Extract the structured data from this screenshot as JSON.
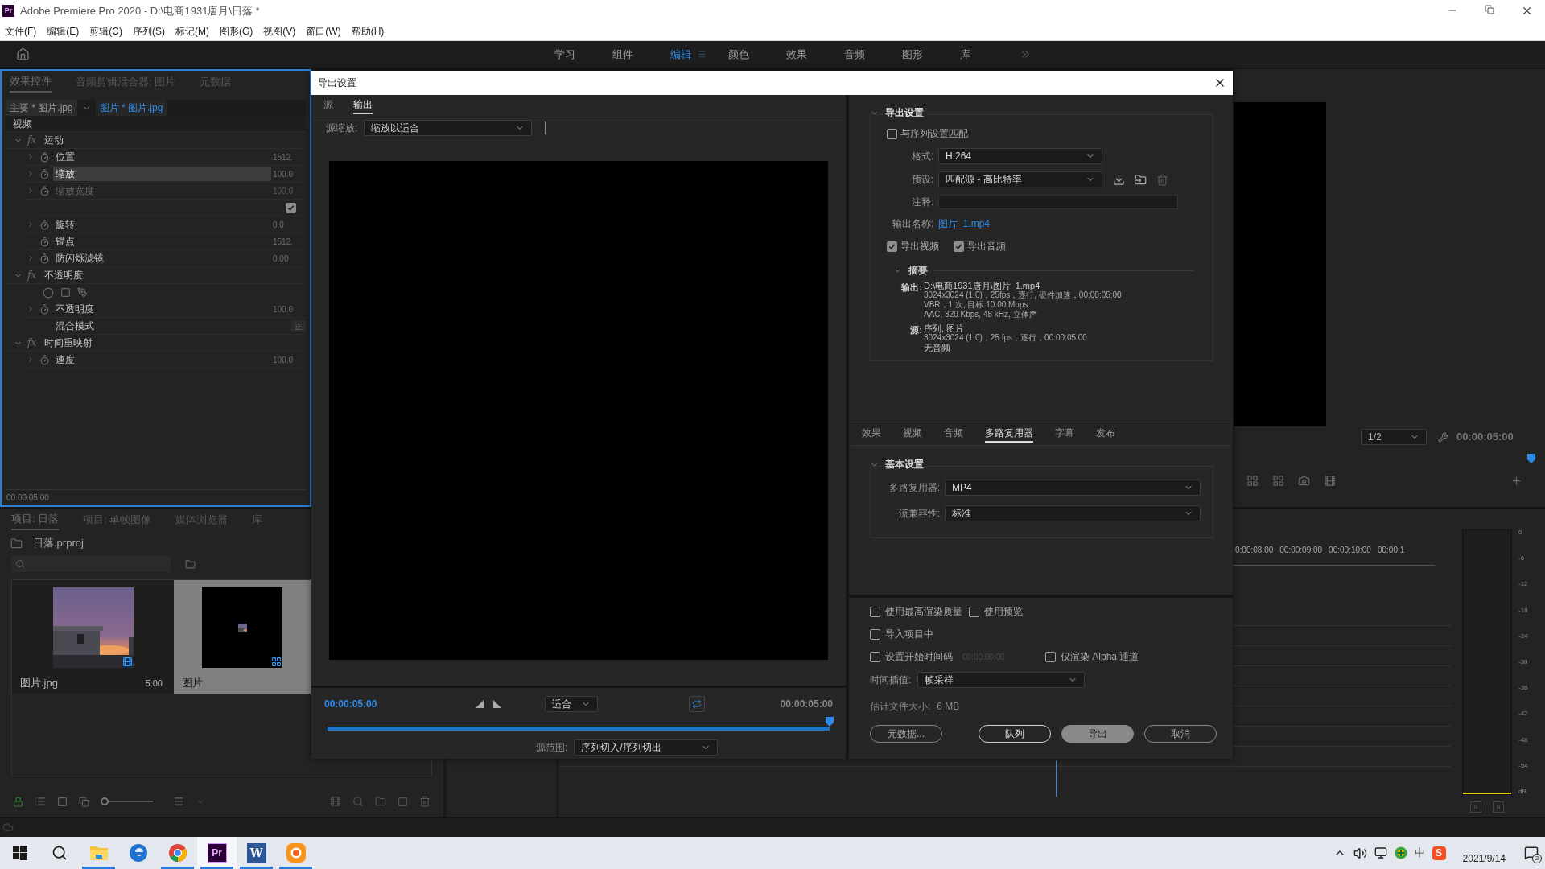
{
  "window": {
    "app_icon": "Pr",
    "title": "Adobe Premiere Pro 2020 - D:\\电商1931唐月\\日落 *"
  },
  "menu": [
    "文件(F)",
    "编辑(E)",
    "剪辑(C)",
    "序列(S)",
    "标记(M)",
    "图形(G)",
    "视图(V)",
    "窗口(W)",
    "帮助(H)"
  ],
  "workspaces": [
    {
      "label": "学习",
      "selected": false
    },
    {
      "label": "组件",
      "selected": false
    },
    {
      "label": "编辑",
      "selected": true
    },
    {
      "label": "颜色",
      "selected": false
    },
    {
      "label": "效果",
      "selected": false
    },
    {
      "label": "音频",
      "selected": false
    },
    {
      "label": "图形",
      "selected": false
    },
    {
      "label": "库",
      "selected": false
    }
  ],
  "effect_controls": {
    "tabs": [
      {
        "label": "效果控件",
        "selected": true
      },
      {
        "label": "音频剪辑混合器: 图片",
        "selected": false
      },
      {
        "label": "元数据",
        "selected": false
      }
    ],
    "clips": [
      {
        "label": "主要 * 图片.jpg",
        "selected": false
      },
      {
        "label": "图片 * 图片.jpg",
        "selected": true
      }
    ],
    "section": "视频",
    "rows": [
      {
        "kind": "effect",
        "badge": "fx",
        "label": "运动",
        "expanded": true
      },
      {
        "kind": "property",
        "label": "位置",
        "value": "1512.",
        "expandable": true,
        "selected": false,
        "disabled": false
      },
      {
        "kind": "property",
        "label": "缩放",
        "value": "100.0",
        "expandable": true,
        "selected": true,
        "disabled": false
      },
      {
        "kind": "property",
        "label": "缩放宽度",
        "value": "100.0",
        "expandable": true,
        "selected": false,
        "disabled": true
      },
      {
        "kind": "checkbox",
        "checked": true
      },
      {
        "kind": "property",
        "label": "旋转",
        "value": "0.0",
        "expandable": true,
        "selected": false,
        "disabled": false
      },
      {
        "kind": "property",
        "label": "锚点",
        "value": "1512.",
        "expandable": false,
        "selected": false,
        "disabled": false
      },
      {
        "kind": "property",
        "label": "防闪烁滤镜",
        "value": "0.00",
        "expandable": true,
        "selected": false,
        "disabled": false
      },
      {
        "kind": "effect",
        "badge": "fx",
        "label": "不透明度",
        "expanded": true
      },
      {
        "kind": "mask_tools"
      },
      {
        "kind": "property",
        "label": "不透明度",
        "value": "100.0",
        "expandable": true,
        "selected": false,
        "disabled": false
      },
      {
        "kind": "dropdown",
        "label": "混合模式",
        "value": "正"
      },
      {
        "kind": "effect",
        "badge": "fx",
        "label": "时间重映射",
        "expanded": true
      },
      {
        "kind": "property",
        "label": "速度",
        "value": "100.0",
        "expandable": true,
        "selected": false,
        "disabled": false
      }
    ],
    "timecode": "00:00:05:00"
  },
  "project": {
    "tabs": [
      {
        "label": "项目: 日落",
        "selected": true
      },
      {
        "label": "项目: 单帧图像",
        "selected": false
      },
      {
        "label": "媒体浏览器",
        "selected": false
      },
      {
        "label": "库",
        "selected": false
      }
    ],
    "bin": "日落.prproj",
    "thumbnail_size": {
      "level": 0
    },
    "items": [
      {
        "kind": "clip",
        "name": "图片.jpg",
        "duration": "5:00",
        "selected": false
      },
      {
        "kind": "sequence",
        "name": "图片",
        "selected": true
      }
    ]
  },
  "program_monitor": {
    "zoom": "1/2",
    "timecode": "00:00:05:00"
  },
  "timeline": {
    "ruler": [
      "0:00:08:00",
      "00:00:09:00",
      "00:00:10:00",
      "00:00:1"
    ]
  },
  "audio_meter": {
    "scale": [
      "0",
      "-6",
      "-12",
      "-18",
      "-24",
      "-30",
      "-36",
      "-42",
      "-48",
      "-54",
      "dB"
    ],
    "solo_buttons": [
      "S",
      "S"
    ]
  },
  "dialog": {
    "title": "导出设置",
    "tabs": [
      {
        "label": "源",
        "selected": false
      },
      {
        "label": "输出",
        "selected": true
      }
    ],
    "source_scaling": {
      "label": "源缩放:",
      "value": "缩放以适合"
    },
    "timecode_in": "00:00:05:00",
    "fit": "适合",
    "timecode_out": "00:00:05:00",
    "playhead": {
      "level": 1
    },
    "source_range": {
      "label": "源范围:",
      "value": "序列切入/序列切出"
    },
    "export_settings": {
      "title": "导出设置",
      "expanded": true,
      "match_sequence": {
        "label": "与序列设置匹配",
        "checked": false
      },
      "format": {
        "label": "格式:",
        "value": "H.264"
      },
      "preset": {
        "label": "预设:",
        "value": "匹配源 - 高比特率"
      },
      "comments": {
        "label": "注释:"
      },
      "output_name": {
        "label": "输出名称:",
        "value": "图片_1.mp4"
      },
      "export_video": {
        "label": "导出视频",
        "checked": true
      },
      "export_audio": {
        "label": "导出音频",
        "checked": true
      },
      "summary": {
        "title": "摘要",
        "expanded": true,
        "groups": [
          {
            "label": "输出:",
            "lines": [
              "D:\\电商1931唐月\\图片_1.mp4",
              "3024x3024 (1.0)，25fps，逐行, 硬件加速，00:00:05:00",
              "VBR，1 次, 目标 10.00 Mbps",
              "AAC, 320 Kbps, 48  kHz, 立体声"
            ]
          },
          {
            "label": "源:",
            "lines": [
              "序列, 图片",
              "3024x3024 (1.0)，25 fps，逐行，00:00:05:00",
              "无音频"
            ]
          }
        ]
      }
    },
    "settings_tabs": [
      {
        "label": "效果",
        "selected": false
      },
      {
        "label": "视频",
        "selected": false
      },
      {
        "label": "音频",
        "selected": false
      },
      {
        "label": "多路复用器",
        "selected": true
      },
      {
        "label": "字幕",
        "selected": false
      },
      {
        "label": "发布",
        "selected": false
      }
    ],
    "basic_settings": {
      "title": "基本设置",
      "expanded": true,
      "fields": [
        {
          "label": "多路复用器:",
          "value": "MP4"
        },
        {
          "label": "流兼容性:",
          "value": "标准"
        }
      ]
    },
    "options": [
      {
        "label": "使用最高渲染质量",
        "checked": false
      },
      {
        "label": "使用预览",
        "checked": false
      },
      {
        "label": "导入项目中",
        "checked": false
      },
      {
        "label": "设置开始时间码",
        "checked": false,
        "value": "00:00:00:00"
      },
      {
        "label": "仅渲染 Alpha 通道",
        "checked": false
      }
    ],
    "time_interpolation": {
      "label": "时间插值:",
      "value": "帧采样"
    },
    "file_size": {
      "label": "估计文件大小:",
      "value": "6 MB"
    },
    "buttons": [
      {
        "label": "元数据...",
        "kind": "secondary"
      },
      {
        "label": "队列",
        "kind": "outlined"
      },
      {
        "label": "导出",
        "kind": "primary"
      },
      {
        "label": "取消",
        "kind": "secondary"
      }
    ]
  },
  "taskbar": {
    "apps": [
      {
        "kind": "start",
        "running": false,
        "selected": false
      },
      {
        "kind": "search",
        "running": false,
        "selected": false
      },
      {
        "kind": "explorer",
        "running": true,
        "selected": false
      },
      {
        "kind": "edge",
        "running": false,
        "selected": false
      },
      {
        "kind": "chrome",
        "running": true,
        "selected": false
      },
      {
        "kind": "premiere",
        "label": "Pr",
        "running": true,
        "selected": true
      },
      {
        "kind": "word",
        "label": "W",
        "running": true,
        "selected": false
      },
      {
        "kind": "orange",
        "running": true,
        "selected": false
      }
    ],
    "tray": [
      {
        "kind": "chevron"
      },
      {
        "kind": "speaker"
      },
      {
        "kind": "network"
      },
      {
        "kind": "shield"
      },
      {
        "kind": "ime",
        "label": "中"
      },
      {
        "kind": "sogou",
        "label": "S"
      }
    ],
    "date": "2021/9/14",
    "notifications": "2"
  }
}
